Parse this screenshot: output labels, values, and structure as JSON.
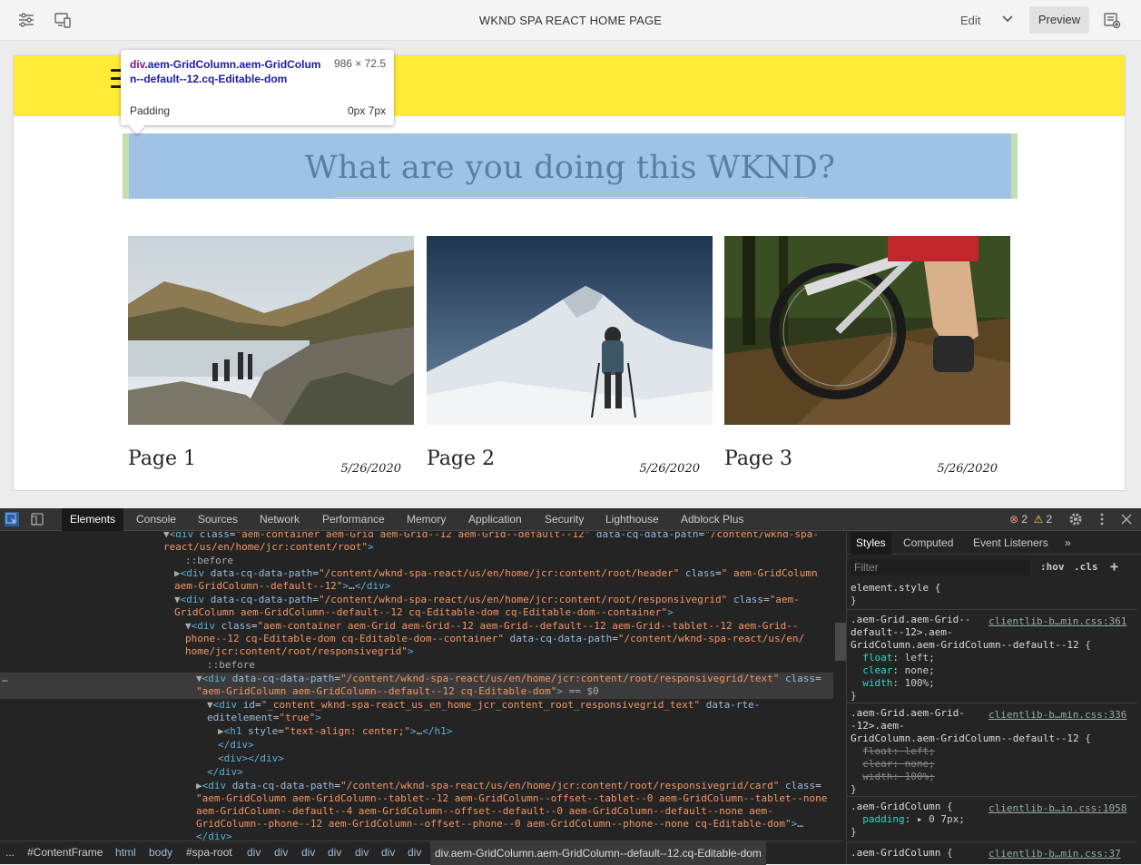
{
  "toolbar": {
    "title": "WKND SPA REACT HOME PAGE",
    "mode": "Edit",
    "preview": "Preview",
    "icons": [
      "properties-icon",
      "emulator-icon",
      "chevron-down-icon",
      "annotations-icon"
    ]
  },
  "tooltip": {
    "selector_tag": "div",
    "selector_classes": ".aem-GridColumn.aem-GridColumn--default--12.cq-Editable-dom",
    "size": "986 × 72.5",
    "padding_label": "Padding",
    "padding_value": "0px 7px"
  },
  "page": {
    "heading": "What are you doing this WKND?",
    "cards": [
      {
        "title": "Page 1",
        "date": "5/26/2020"
      },
      {
        "title": "Page 2",
        "date": "5/26/2020"
      },
      {
        "title": "Page 3",
        "date": "5/26/2020"
      }
    ]
  },
  "devtools": {
    "tabs": [
      "Elements",
      "Console",
      "Sources",
      "Network",
      "Performance",
      "Memory",
      "Application",
      "Security",
      "Lighthouse",
      "Adblock Plus"
    ],
    "errors": "2",
    "warnings": "2",
    "styles_tabs": [
      "Styles",
      "Computed",
      "Event Listeners",
      "»"
    ],
    "filter_placeholder": "Filter",
    "hov": ":hov",
    "cls": ".cls",
    "plus": "+",
    "breadcrumbs": [
      "...",
      "#ContentFrame",
      "html",
      "body",
      "#spa-root",
      "div",
      "div",
      "div",
      "div",
      "div",
      "div",
      "div",
      "div.aem-GridColumn.aem-GridColumn--default--12.cq-Editable-dom"
    ]
  }
}
